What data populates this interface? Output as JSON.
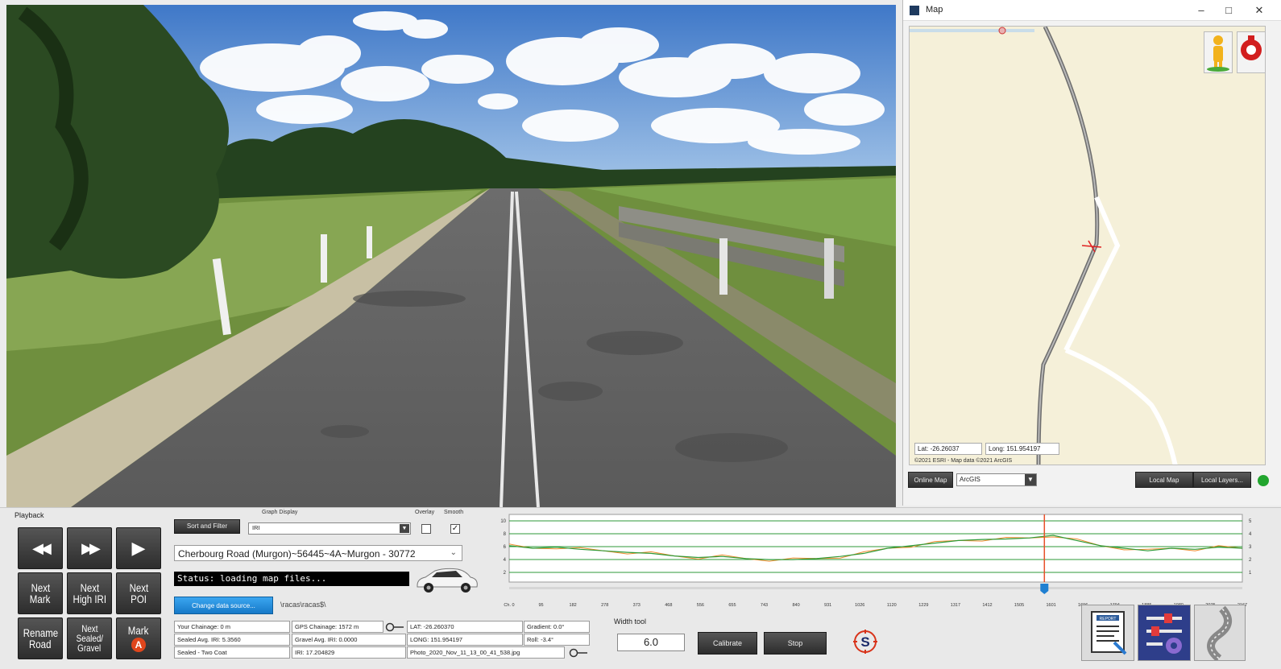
{
  "map_window": {
    "title": "Map",
    "minimize": "–",
    "maximize": "□",
    "close": "✕",
    "lat": "Lat: -26.26037",
    "long": "Long: 151.954197",
    "attribution": "©2021 ESRI - Map data ©2021 ArcGIS",
    "online_map_label": "Online Map",
    "source_value": "ArcGIS",
    "local_map_label": "Local Map",
    "local_layers_label": "Local Layers..."
  },
  "playback": {
    "title": "Playback",
    "rewind_icon": "◀◀",
    "fast_forward_icon": "▶▶",
    "play_icon": "▶",
    "next_mark": [
      "Next",
      "Mark"
    ],
    "next_high_iri": [
      "Next",
      "High IRI"
    ],
    "next_poi": [
      "Next",
      "POI"
    ],
    "rename_road": [
      "Rename",
      "Road"
    ],
    "next_sealed_gravel": [
      "Next",
      "Sealed/",
      "Gravel"
    ],
    "mark": "Mark",
    "mark_badge": "A"
  },
  "controls": {
    "sort_filter_label": "Sort and Filter",
    "graph_display_label": "Graph Display",
    "graph_display_value": "IRI",
    "overlay_label": "Overlay",
    "smooth_label": "Smooth",
    "overlay_checked": false,
    "smooth_checked": true,
    "smooth_check_glyph": "✓",
    "road_value": "Cherbourg Road (Murgon)~56445~4A~Murgon - 30772",
    "road_chevron": "⌄",
    "status_text": "Status: loading map files...",
    "change_source_label": "Change data source...",
    "source_path": "\\racas\\racas$\\"
  },
  "info": {
    "your_chainage": "Your Chainage: 0 m",
    "gps_chainage": "GPS Chainage: 1572 m",
    "lat": "LAT: -26.260370",
    "gradient": "Gradient: 0.0°",
    "sealed_avg_iri": "Sealed Avg. IRI: 5.3560",
    "gravel_avg_iri": "Gravel Avg. IRI: 0.0000",
    "long": "LONG: 151.954197",
    "roll": "Roll: -3.4°",
    "surface_type": "Sealed - Two Coat",
    "iri": "IRI: 17.204829",
    "photo_file": "Photo_2020_Nov_11_13_00_41_538.jpg"
  },
  "graph": {
    "y_ticks": [
      "10",
      "8",
      "6",
      "4",
      "2"
    ],
    "right_ticks": [
      "5",
      "4",
      "3",
      "2",
      "1"
    ],
    "x_ticks": [
      "Ch. 0",
      "95",
      "182",
      "278",
      "373",
      "468",
      "556",
      "655",
      "743",
      "840",
      "931",
      "1026",
      "1120",
      "1229",
      "1317",
      "1412",
      "1505",
      "1601",
      "1696",
      "1794",
      "1885",
      "1980",
      "2075",
      "2167"
    ],
    "colors": {
      "series": "#2e9a37",
      "overlay": "#f08c2e",
      "marker": "#e8502a",
      "grid": "#2e9a37"
    }
  },
  "width_tool": {
    "label": "Width tool",
    "value": "6.0",
    "calibrate_label": "Calibrate",
    "stop_label": "Stop"
  },
  "icons": {
    "compass": "compass-icon",
    "compass_letter": "S",
    "report": "report-icon",
    "report_text": "REPORT",
    "settings": "settings-sliders-icon",
    "road_curve": "road-curve-icon"
  }
}
